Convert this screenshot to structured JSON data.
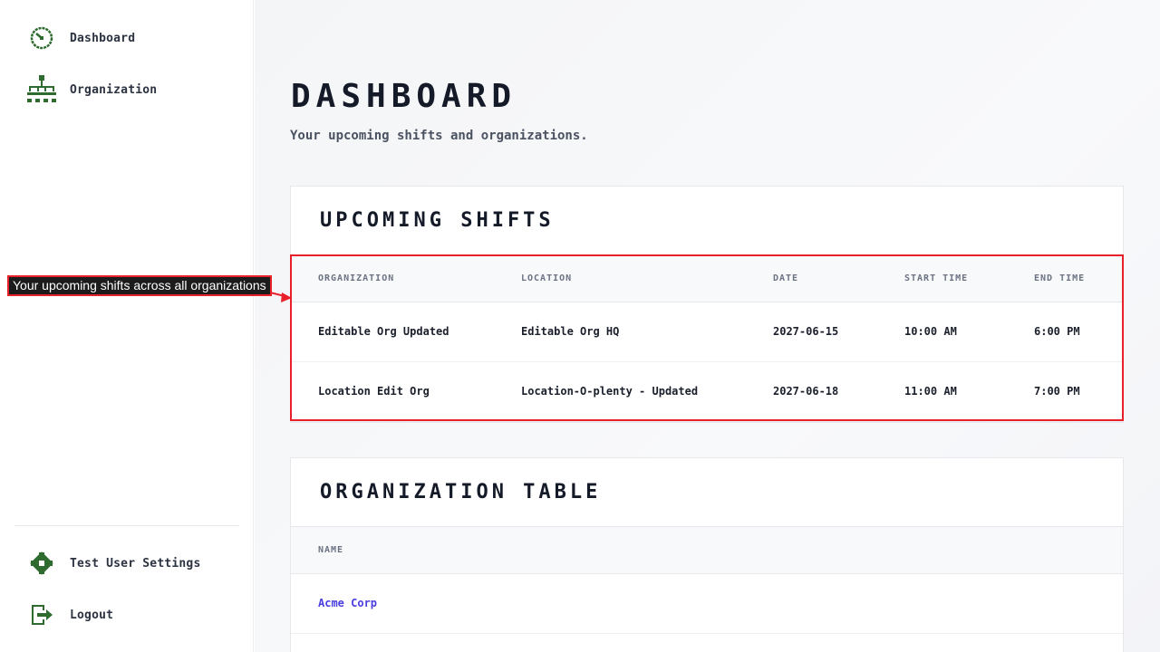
{
  "sidebar": {
    "nav": [
      {
        "label": "Dashboard",
        "icon": "dashboard-gauge-icon"
      },
      {
        "label": "Organization",
        "icon": "org-chart-icon"
      }
    ],
    "bottom": [
      {
        "label": "Test User Settings",
        "icon": "gear-icon"
      },
      {
        "label": "Logout",
        "icon": "logout-icon"
      }
    ]
  },
  "page": {
    "title": "DASHBOARD",
    "subtitle": "Your upcoming shifts and organizations."
  },
  "shifts": {
    "title": "UPCOMING SHIFTS",
    "columns": [
      "ORGANIZATION",
      "LOCATION",
      "DATE",
      "START TIME",
      "END TIME"
    ],
    "rows": [
      [
        "Editable Org Updated",
        "Editable Org HQ",
        "2027-06-15",
        "10:00 AM",
        "6:00 PM"
      ],
      [
        "Location Edit Org",
        "Location-O-plenty - Updated",
        "2027-06-18",
        "11:00 AM",
        "7:00 PM"
      ]
    ]
  },
  "organizations": {
    "title": "ORGANIZATION TABLE",
    "columns": [
      "NAME"
    ],
    "rows": [
      [
        "Acme Corp"
      ]
    ]
  },
  "annotation": {
    "text": "Your upcoming shifts across all organizations"
  },
  "colors": {
    "icon_green": "#2f6b2f",
    "highlight_red": "#e8202a",
    "link_purple": "#4a3ee0"
  }
}
